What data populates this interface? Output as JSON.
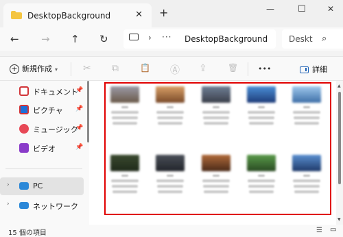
{
  "window": {
    "tab_title": "DesktopBackground",
    "tab_close": "✕",
    "new_tab": "+",
    "minimize": "—",
    "maximize": "☐",
    "close": "✕"
  },
  "nav": {
    "back": "←",
    "forward": "→",
    "up": "↑",
    "refresh": "↻"
  },
  "address": {
    "separator": "›",
    "more": "···",
    "location": "DesktopBackground",
    "search_placeholder": "Deskt",
    "search_icon": "⌕"
  },
  "toolbar": {
    "new_label": "新規作成",
    "new_plus": "+",
    "new_chevron": "▾",
    "cut": "✂",
    "copy": "⧉",
    "paste": "📋",
    "rename": "Ⓐ",
    "share": "⇪",
    "delete": "🗑",
    "more": "•••",
    "details_label": "詳細"
  },
  "sidebar": {
    "items": [
      {
        "label": "ドキュメント",
        "pinned": true
      },
      {
        "label": "ピクチャ",
        "pinned": true
      },
      {
        "label": "ミュージック",
        "pinned": true
      },
      {
        "label": "ビデオ",
        "pinned": true
      },
      {
        "label": "PC",
        "selected": true
      },
      {
        "label": "ネットワーク"
      }
    ],
    "pin_glyph": "📌",
    "expand_glyph": "›"
  },
  "colors": {
    "folder": "#f4c542",
    "highlight_frame": "#e00000",
    "documents_icon": "#d13438",
    "pictures_icon": "#1e6fd9",
    "music_icon": "#e74856",
    "videos_icon": "#8a3cc9",
    "pc_icon": "#2b88d8"
  },
  "status": {
    "count": "15 個の項目",
    "view_details": "☰",
    "view_tiles": "▭"
  },
  "scroll": {
    "up": "▲",
    "down": "▼"
  }
}
